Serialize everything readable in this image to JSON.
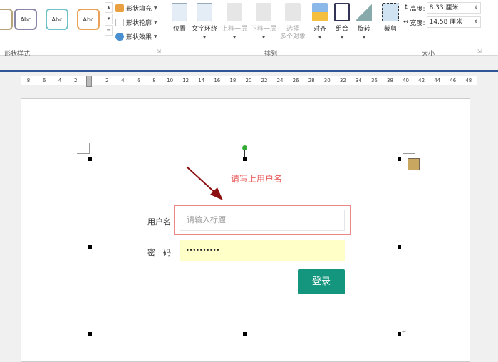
{
  "ribbon": {
    "gallery": [
      "Abc",
      "Abc",
      "Abc"
    ],
    "shape_fill": "形状填充",
    "shape_outline": "形状轮廓",
    "shape_effect": "形状效果",
    "group_shape_style": "形状样式",
    "position": "位置",
    "text_wrap": "文字环绕",
    "bring_forward": "上移一层",
    "send_backward": "下移一层",
    "select_multi_1": "选择",
    "select_multi_2": "多个对象",
    "align": "对齐",
    "group": "组合",
    "rotate": "旋转",
    "group_arrange": "排列",
    "crop": "裁剪",
    "height_label": "高度:",
    "height_value": "8.33 厘米",
    "width_label": "宽度:",
    "width_value": "14.58 厘米",
    "group_size": "大小"
  },
  "ruler": [
    "8",
    "6",
    "4",
    "2",
    "",
    "2",
    "4",
    "6",
    "8",
    "10",
    "12",
    "14",
    "16",
    "18",
    "20",
    "22",
    "24",
    "26",
    "28",
    "30",
    "32",
    "34",
    "36",
    "38",
    "40",
    "42",
    "44",
    "46",
    "48"
  ],
  "doc": {
    "hint": "请写上用户名",
    "username_label": "用户名",
    "username_placeholder": "请输入标题",
    "password_label": "密　码",
    "password_value": "••••••••••",
    "login_button": "登录"
  },
  "colors": {
    "accent": "#14957d",
    "hint": "#e85a5a",
    "password_bg": "#ffffc8"
  }
}
